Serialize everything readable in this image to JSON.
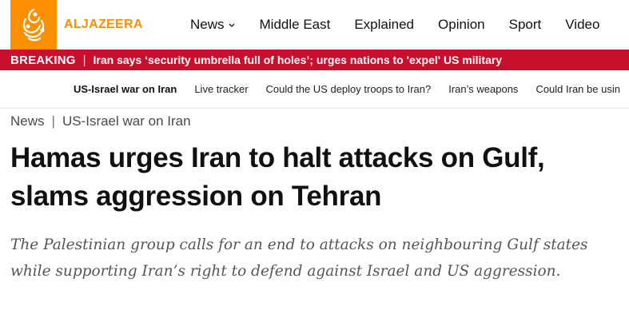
{
  "brand": {
    "name": "ALJAZEERA",
    "accent_color": "#fa9000",
    "breaking_color": "#c8102e"
  },
  "nav": {
    "items": [
      {
        "label": "News",
        "icon": "chevron-down-icon"
      },
      {
        "label": "Middle East"
      },
      {
        "label": "Explained"
      },
      {
        "label": "Opinion"
      },
      {
        "label": "Sport"
      },
      {
        "label": "Video"
      }
    ]
  },
  "breaking": {
    "label": "BREAKING",
    "separator": "|",
    "text": "Iran says ‘security umbrella full of holes’; urges nations to 'expel' US military"
  },
  "subnav": {
    "title": "US-Israel war on Iran",
    "items": [
      "Live tracker",
      "Could the US deploy troops to Iran?",
      "Iran’s weapons",
      "Could Iran be usin"
    ]
  },
  "breadcrumb": {
    "items": [
      "News",
      "US-Israel war on Iran"
    ],
    "separator": "|"
  },
  "article": {
    "headline": "Hamas urges Iran to halt attacks on Gulf, slams aggression on Tehran",
    "standfirst": "The Palestinian group calls for an end to attacks on neighbouring Gulf states while supporting Iran’s right to defend against Israel and US aggression."
  }
}
